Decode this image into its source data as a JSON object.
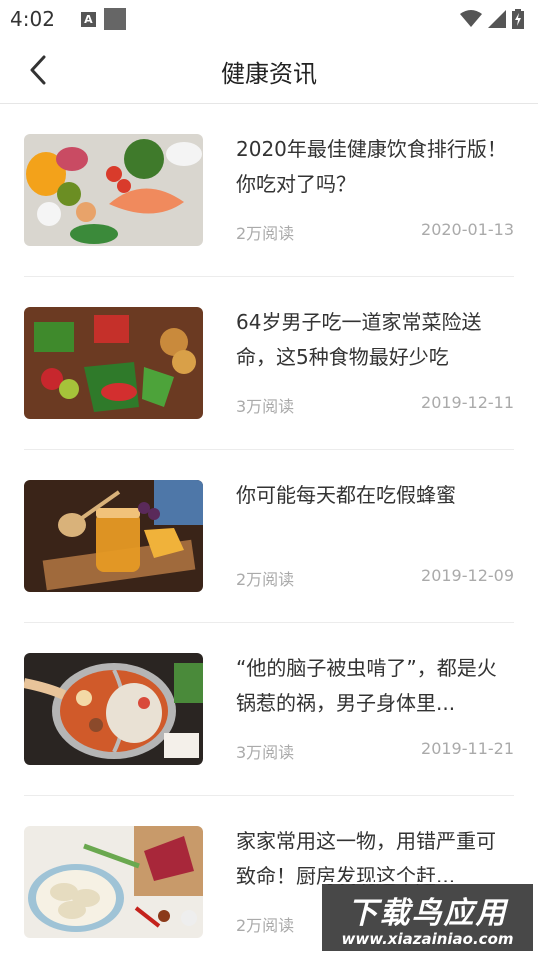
{
  "status_bar": {
    "time": "4:02",
    "icons": [
      "notification-a-icon",
      "notification-square-icon",
      "wifi-icon",
      "signal-icon",
      "battery-icon"
    ]
  },
  "header": {
    "title": "健康资讯",
    "back_icon": "chevron-left-icon"
  },
  "articles": [
    {
      "title": "2020年最佳健康饮食排行版！你吃对了吗？",
      "reads": "2万阅读",
      "date": "2020-01-13",
      "image": "healthy-food-spread-image"
    },
    {
      "title": "64岁男子吃一道家常菜险送命，这5种食物最好少吃",
      "reads": "3万阅读",
      "date": "2019-12-11",
      "image": "vegetables-on-wood-image"
    },
    {
      "title": "你可能每天都在吃假蜂蜜",
      "reads": "2万阅读",
      "date": "2019-12-09",
      "image": "honey-jar-image"
    },
    {
      "title": "“他的脑子被虫啃了”，都是火锅惹的祸，男子身体里...",
      "reads": "3万阅读",
      "date": "2019-11-21",
      "image": "hotpot-image"
    },
    {
      "title": "家家常用这一物，用错严重可致命！厨房发现这个赶...",
      "reads": "2万阅读",
      "date": "",
      "image": "dumplings-meat-image"
    }
  ],
  "watermark": {
    "line1": "下载鸟应用",
    "line2": "www.xiazainiao.com"
  },
  "colors": {
    "title_text": "#333333",
    "meta_text": "#aaaaaa",
    "divider": "#ececec"
  }
}
